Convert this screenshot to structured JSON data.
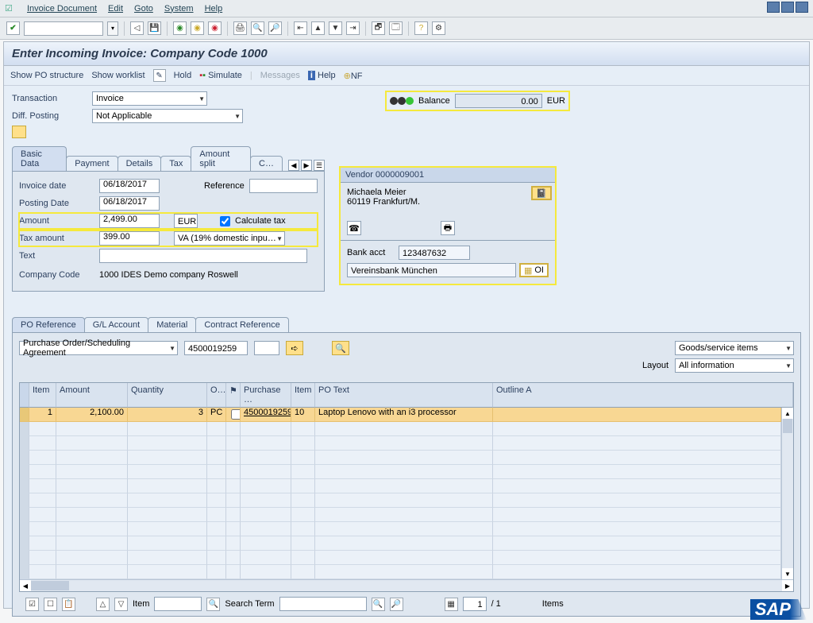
{
  "menu": {
    "items": [
      "Invoice Document",
      "Edit",
      "Goto",
      "System",
      "Help"
    ]
  },
  "std_toolbar_icons": [
    "◁",
    "💾",
    "|",
    "🔙",
    "🔜",
    "🌐",
    "|",
    "📄",
    "📋",
    "📑",
    "|",
    "🔀",
    "↕",
    "↔",
    "↗",
    "|",
    "🗂",
    "🗔",
    "|",
    "❓",
    "📋"
  ],
  "page_title": "Enter Incoming Invoice: Company Code 1000",
  "subtoolbar": {
    "show_po": "Show PO structure",
    "show_worklist": "Show worklist",
    "hold": "Hold",
    "simulate": "Simulate",
    "messages": "Messages",
    "help": "Help",
    "nf": "NF"
  },
  "form": {
    "transaction_label": "Transaction",
    "transaction_value": "Invoice",
    "diffposting_label": "Diff. Posting",
    "diffposting_value": "Not Applicable",
    "balance_label": "Balance",
    "balance_value": "0.00",
    "balance_curr": "EUR"
  },
  "tabs1": [
    "Basic Data",
    "Payment",
    "Details",
    "Tax",
    "Amount split",
    "C…"
  ],
  "basic": {
    "invoice_date_label": "Invoice date",
    "invoice_date": "06/18/2017",
    "reference_label": "Reference",
    "reference": "",
    "posting_date_label": "Posting Date",
    "posting_date": "06/18/2017",
    "amount_label": "Amount",
    "amount": "2,499.00",
    "amount_curr": "EUR",
    "calc_tax_label": "Calculate tax",
    "tax_amount_label": "Tax amount",
    "tax_amount": "399.00",
    "tax_code": "VA (19% domestic inpu…",
    "text_label": "Text",
    "text": "",
    "company_code_label": "Company Code",
    "company_code": "1000 IDES Demo company Roswell"
  },
  "vendor": {
    "header": "Vendor 0000009001",
    "name": "Michaela Meier",
    "city": "60119 Frankfurt/M.",
    "bank_label": "Bank acct",
    "bank_acct": "123487632",
    "bank_name": "Vereinsbank München",
    "oi": "OI"
  },
  "tabs2": [
    "PO Reference",
    "G/L Account",
    "Material",
    "Contract Reference"
  ],
  "po_panel": {
    "ref_type": "Purchase Order/Scheduling Agreement",
    "po_number": "4500019259",
    "goods_service": "Goods/service items",
    "layout_label": "Layout",
    "layout_value": "All information"
  },
  "grid": {
    "cols": [
      "Item",
      "Amount",
      "Quantity",
      "O…",
      "",
      "Purchase …",
      "Item",
      "PO Text",
      "Outline A"
    ],
    "row1": {
      "item": "1",
      "amount": "2,100.00",
      "qty": "3",
      "uom": "PC",
      "po": "4500019259",
      "po_item": "10",
      "text": "Laptop Lenovo with an i3 processor"
    }
  },
  "bottom": {
    "item_label": "Item",
    "search_label": "Search Term",
    "page_cur": "1",
    "page_sep": "/  1",
    "items_label": "Items"
  }
}
